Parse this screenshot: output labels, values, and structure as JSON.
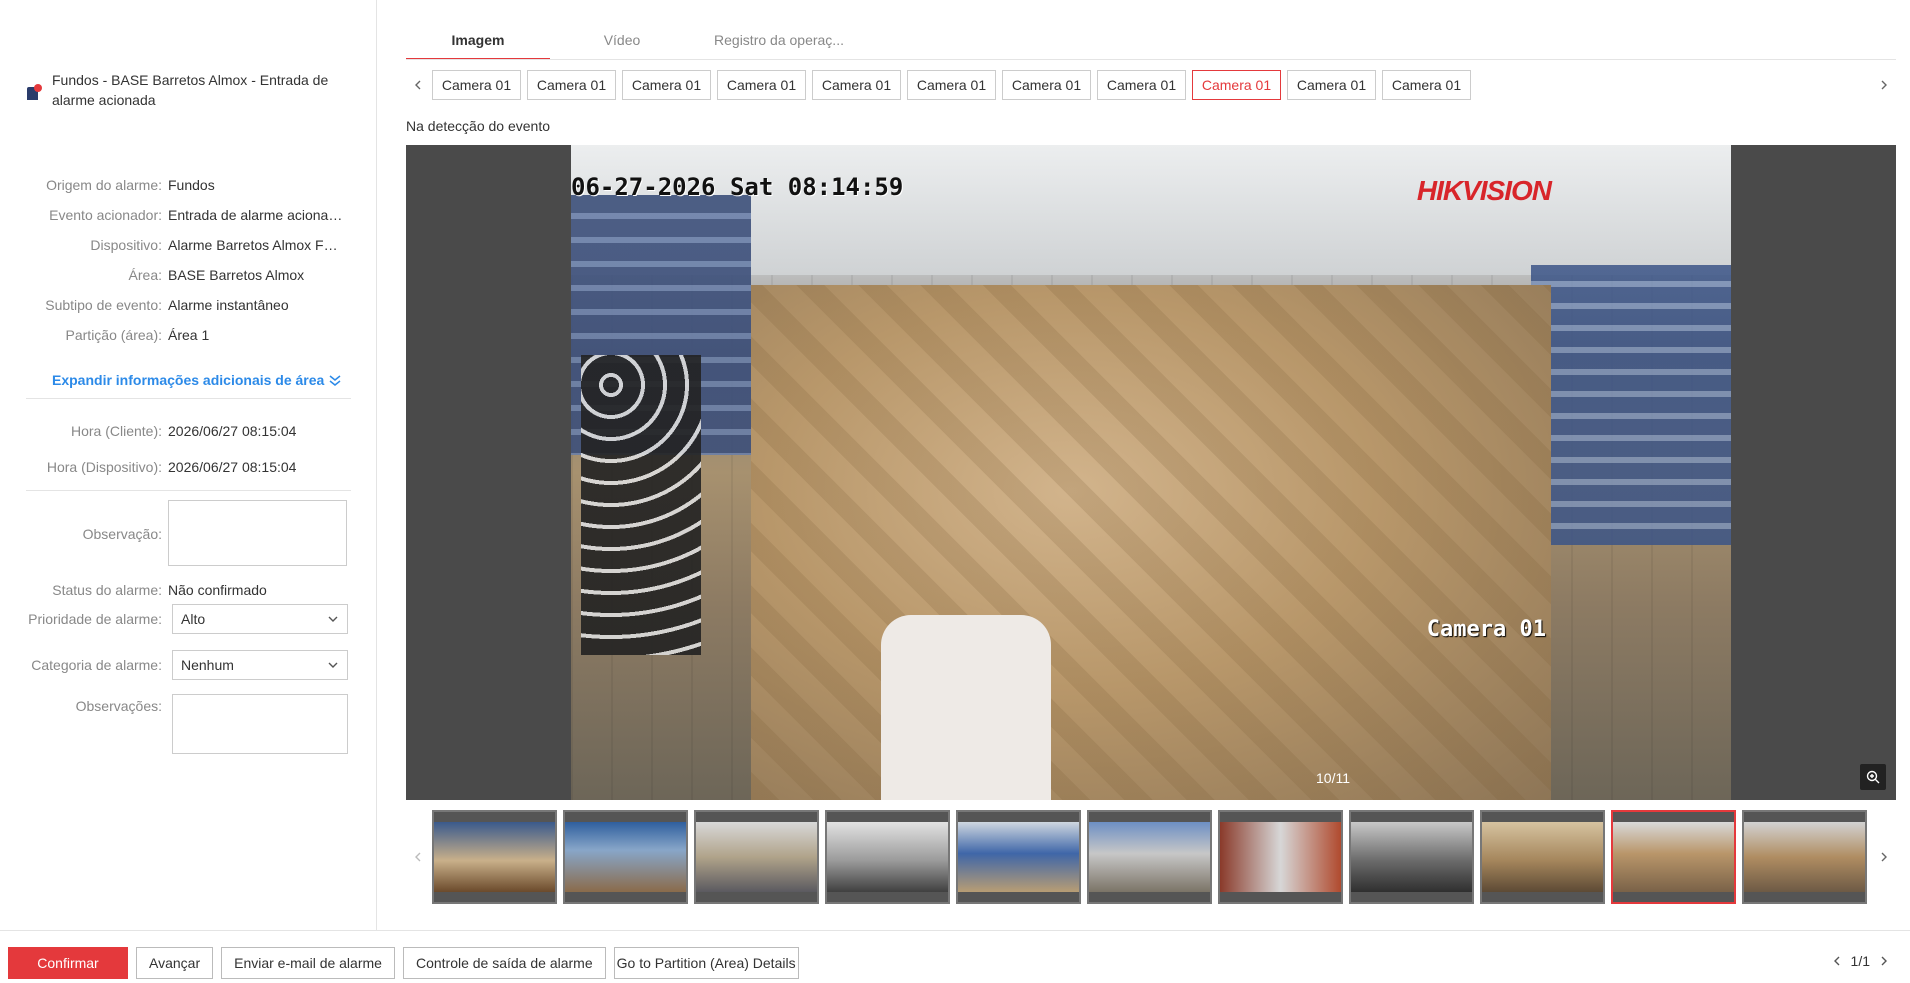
{
  "alarm": {
    "title": "Fundos - BASE Barretos Almox - Entrada de alarme acionada"
  },
  "info": [
    {
      "label": "Origem do alarme:",
      "value": "Fundos"
    },
    {
      "label": "Evento acionador:",
      "value": "Entrada de alarme acionada"
    },
    {
      "label": "Dispositivo:",
      "value": "Alarme Barretos Almox FR..."
    },
    {
      "label": "Área:",
      "value": "BASE Barretos Almox"
    },
    {
      "label": "Subtipo de evento:",
      "value": "Alarme instantâneo"
    },
    {
      "label": "Partição (área):",
      "value": "Área 1"
    }
  ],
  "expand_label": "Expandir informações adicionais de área",
  "times": [
    {
      "label": "Hora (Cliente):",
      "value": "2026/06/27 08:15:04"
    },
    {
      "label": "Hora (Dispositivo):",
      "value": "2026/06/27 08:15:04"
    }
  ],
  "form": {
    "observation_label": "Observação:",
    "status_label": "Status do alarme:",
    "status_value": "Não confirmado",
    "priority_label": "Prioridade de alarme:",
    "priority_value": "Alto",
    "category_label": "Categoria de alarme:",
    "category_value": "Nenhum",
    "remarks_label": "Observações:"
  },
  "tabs": [
    "Imagem",
    "Vídeo",
    "Registro da operaç..."
  ],
  "cameras": [
    "Camera 01",
    "Camera 01",
    "Camera 01",
    "Camera 01",
    "Camera 01",
    "Camera 01",
    "Camera 01",
    "Camera 01",
    "Camera 01",
    "Camera 01",
    "Camera 01"
  ],
  "active_camera_index": 8,
  "detection_label": "Na detecção do evento",
  "viewer": {
    "timestamp": "06-27-2026 Sat 08:14:59",
    "brand": "HIKVISION",
    "camera_overlay": "Camera 01",
    "counter": "10/11"
  },
  "thumbnails_count": 11,
  "active_thumbnail_index": 9,
  "buttons": {
    "confirm": "Confirmar",
    "advance": "Avançar",
    "email": "Enviar e-mail de alarme",
    "exit_control": "Controle de saída de alarme",
    "partition": "Go to Partition (Area) Details"
  },
  "pager": "1/1",
  "colors": {
    "accent": "#e4393c",
    "link": "#2c8ae8"
  }
}
